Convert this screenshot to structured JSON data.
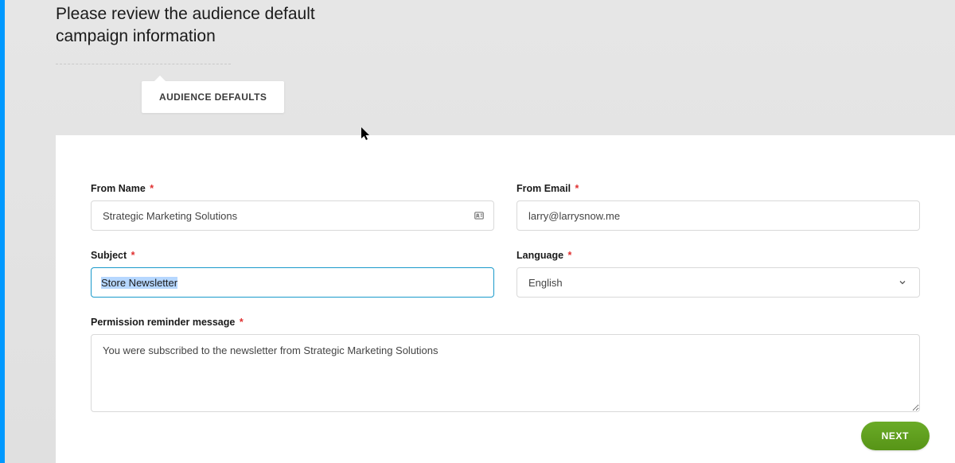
{
  "heading": "Please review the audience default campaign information",
  "tab": {
    "label": "AUDIENCE DEFAULTS"
  },
  "form": {
    "fromName": {
      "label": "From Name",
      "value": "Strategic Marketing Solutions"
    },
    "fromEmail": {
      "label": "From Email",
      "value": "larry@larrysnow.me"
    },
    "subject": {
      "label": "Subject",
      "value": "Store Newsletter"
    },
    "language": {
      "label": "Language",
      "value": "English"
    },
    "permission": {
      "label": "Permission reminder message",
      "value": "You were subscribed to the newsletter from Strategic Marketing Solutions"
    }
  },
  "buttons": {
    "next": "NEXT"
  }
}
